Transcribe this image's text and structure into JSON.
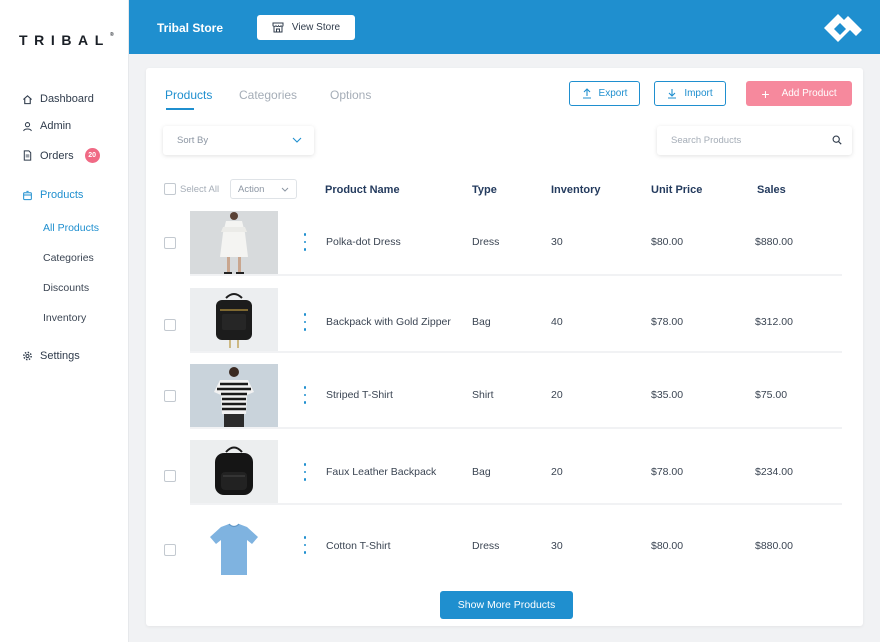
{
  "brand": {
    "logo_text": "TRIBAL",
    "logo_mark": "®"
  },
  "sidebar": {
    "items": [
      {
        "label": "Dashboard",
        "icon": "home-icon"
      },
      {
        "label": "Admin",
        "icon": "user-icon"
      },
      {
        "label": "Orders",
        "icon": "document-icon",
        "badge": "20"
      },
      {
        "label": "Products",
        "icon": "box-icon"
      },
      {
        "label": "Settings",
        "icon": "gear-icon"
      }
    ],
    "product_subitems": [
      {
        "label": "All Products"
      },
      {
        "label": "Categories"
      },
      {
        "label": "Discounts"
      },
      {
        "label": "Inventory"
      }
    ]
  },
  "header": {
    "store_title": "Tribal Store",
    "view_store_label": "View Store"
  },
  "tabs": [
    {
      "label": "Products"
    },
    {
      "label": "Categories"
    },
    {
      "label": "Options"
    }
  ],
  "toolbar": {
    "export_label": "Export",
    "import_label": "Import",
    "add_product_label": "Add Product"
  },
  "filters": {
    "sort_by_label": "Sort By",
    "search_placeholder": "Search Products",
    "select_all_label": "Select All",
    "action_label": "Action"
  },
  "table": {
    "columns": [
      "Product Name",
      "Type",
      "Inventory",
      "Unit Price",
      "Sales"
    ],
    "rows": [
      {
        "name": "Polka-dot Dress",
        "type": "Dress",
        "inventory": "30",
        "unit_price": "$80.00",
        "sales": "$880.00",
        "thumb": "dress"
      },
      {
        "name": "Backpack with Gold Zipper",
        "type": "Bag",
        "inventory": "40",
        "unit_price": "$78.00",
        "sales": "$312.00",
        "thumb": "backpack"
      },
      {
        "name": "Striped T-Shirt",
        "type": "Shirt",
        "inventory": "20",
        "unit_price": "$35.00",
        "sales": "$75.00",
        "thumb": "striped-shirt"
      },
      {
        "name": "Faux Leather Backpack",
        "type": "Bag",
        "inventory": "20",
        "unit_price": "$78.00",
        "sales": "$234.00",
        "thumb": "leather-backpack"
      },
      {
        "name": "Cotton T-Shirt",
        "type": "Dress",
        "inventory": "30",
        "unit_price": "$80.00",
        "sales": "$880.00",
        "thumb": "tshirt"
      }
    ]
  },
  "footer": {
    "show_more_label": "Show More Products"
  },
  "colors": {
    "accent": "#1f8fcf",
    "add_button": "#f6899d",
    "badge": "#f06a85"
  }
}
